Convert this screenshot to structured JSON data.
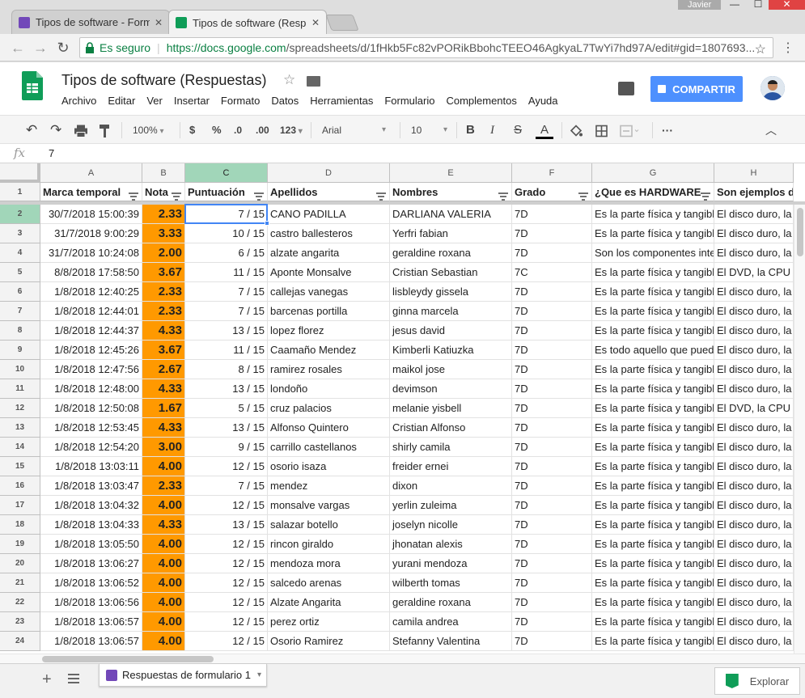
{
  "browser": {
    "tabs": [
      {
        "title": "Tipos de software - Form",
        "favicon_color": "#7248b9"
      },
      {
        "title": "Tipos de software (Respu",
        "favicon_color": "#0f9d58"
      }
    ],
    "user_name": "Javier",
    "secure_label": "Es seguro",
    "url_host": "https://docs.google.com",
    "url_path": "/spreadsheets/d/1fHkb5Fc82vPORikBbohcTEEO46AgkyaL7TwYi7hd97A/edit#gid=1807693..."
  },
  "doc": {
    "title": "Tipos de software (Respuestas)",
    "menus": [
      "Archivo",
      "Editar",
      "Ver",
      "Insertar",
      "Formato",
      "Datos",
      "Herramientas",
      "Formulario",
      "Complementos",
      "Ayuda"
    ],
    "share_label": "COMPARTIR"
  },
  "format_toolbar": {
    "zoom": "100%",
    "currency": "$",
    "percent": "%",
    "dec_less": ".0",
    "dec_more": ".00",
    "more_formats": "123",
    "font": "Arial",
    "font_size": "10",
    "more": "···"
  },
  "formula_bar": {
    "fx": "fx",
    "value": "7"
  },
  "grid": {
    "col_letters": [
      "A",
      "B",
      "C",
      "D",
      "E",
      "F",
      "G",
      "H"
    ],
    "selected_col": "C",
    "headers": [
      "Marca temporal",
      "Nota",
      "Puntuación",
      "Apellidos",
      "Nombres",
      "Grado",
      "¿Que es HARDWARE",
      "Son ejemplos d"
    ],
    "rows": [
      {
        "n": "2",
        "a": "30/7/2018 15:00:39",
        "b": "2.33",
        "c": "7 / 15",
        "d": "CANO PADILLA",
        "e": "DARLIANA VALERIA",
        "f": "7D",
        "g": "Es la parte física y tangibl",
        "h": "El disco duro, la"
      },
      {
        "n": "3",
        "a": "31/7/2018 9:00:29",
        "b": "3.33",
        "c": "10 / 15",
        "d": "castro ballesteros",
        "e": "Yerfri fabian",
        "f": "7D",
        "g": "Es la parte física y tangibl",
        "h": "El disco duro, la"
      },
      {
        "n": "4",
        "a": "31/7/2018 10:24:08",
        "b": "2.00",
        "c": "6 / 15",
        "d": "alzate angarita",
        "e": "geraldine roxana",
        "f": "7D",
        "g": "Son los componentes inte",
        "h": "El disco duro, la"
      },
      {
        "n": "5",
        "a": "8/8/2018 17:58:50",
        "b": "3.67",
        "c": "11 / 15",
        "d": "Aponte Monsalve",
        "e": "Cristian Sebastian",
        "f": "7C",
        "g": "Es la parte física y tangibl",
        "h": "El DVD, la CPU"
      },
      {
        "n": "6",
        "a": "1/8/2018 12:40:25",
        "b": "2.33",
        "c": "7 / 15",
        "d": "callejas vanegas",
        "e": "lisbleydy gissela",
        "f": "7D",
        "g": "Es la parte física y tangibl",
        "h": "El disco duro, la"
      },
      {
        "n": "7",
        "a": "1/8/2018 12:44:01",
        "b": "2.33",
        "c": "7 / 15",
        "d": "barcenas portilla",
        "e": "ginna marcela",
        "f": "7D",
        "g": "Es la parte física y tangibl",
        "h": "El disco duro, la"
      },
      {
        "n": "8",
        "a": "1/8/2018 12:44:37",
        "b": "4.33",
        "c": "13 / 15",
        "d": "lopez florez",
        "e": "jesus david",
        "f": "7D",
        "g": "Es la parte física y tangibl",
        "h": "El disco duro, la"
      },
      {
        "n": "9",
        "a": "1/8/2018 12:45:26",
        "b": "3.67",
        "c": "11 / 15",
        "d": "Caamaño Mendez",
        "e": "Kimberli Katiuzka",
        "f": "7D",
        "g": "Es todo aquello que pued",
        "h": "El disco duro, la"
      },
      {
        "n": "10",
        "a": "1/8/2018 12:47:56",
        "b": "2.67",
        "c": "8 / 15",
        "d": "ramirez rosales",
        "e": "maikol jose",
        "f": "7D",
        "g": "Es la parte física y tangibl",
        "h": "El disco duro, la"
      },
      {
        "n": "11",
        "a": "1/8/2018 12:48:00",
        "b": "4.33",
        "c": "13 / 15",
        "d": "londoño",
        "e": "devimson",
        "f": "7D",
        "g": "Es la parte física y tangibl",
        "h": "El disco duro, la"
      },
      {
        "n": "12",
        "a": "1/8/2018 12:50:08",
        "b": "1.67",
        "c": "5 / 15",
        "d": "cruz palacios",
        "e": "melanie yisbell",
        "f": "7D",
        "g": "Es la parte física y tangibl",
        "h": "El DVD, la CPU"
      },
      {
        "n": "13",
        "a": "1/8/2018 12:53:45",
        "b": "4.33",
        "c": "13 / 15",
        "d": "Alfonso Quintero",
        "e": "Cristian Alfonso",
        "f": "7D",
        "g": "Es la parte física y tangibl",
        "h": "El disco duro, la"
      },
      {
        "n": "14",
        "a": "1/8/2018 12:54:20",
        "b": "3.00",
        "c": "9 / 15",
        "d": "carrillo castellanos",
        "e": "shirly camila",
        "f": "7D",
        "g": "Es la parte física y tangibl",
        "h": "El disco duro, la"
      },
      {
        "n": "15",
        "a": "1/8/2018 13:03:11",
        "b": "4.00",
        "c": "12 / 15",
        "d": "osorio isaza",
        "e": "freider ernei",
        "f": "7D",
        "g": "Es la parte física y tangibl",
        "h": "El disco duro, la"
      },
      {
        "n": "16",
        "a": "1/8/2018 13:03:47",
        "b": "2.33",
        "c": "7 / 15",
        "d": "mendez",
        "e": "dixon",
        "f": "7D",
        "g": "Es la parte física y tangibl",
        "h": "El disco duro, la"
      },
      {
        "n": "17",
        "a": "1/8/2018 13:04:32",
        "b": "4.00",
        "c": "12 / 15",
        "d": "monsalve vargas",
        "e": "yerlin zuleima",
        "f": "7D",
        "g": "Es la parte física y tangibl",
        "h": "El disco duro, la"
      },
      {
        "n": "18",
        "a": "1/8/2018 13:04:33",
        "b": "4.33",
        "c": "13 / 15",
        "d": "salazar botello",
        "e": "joselyn nicolle",
        "f": "7D",
        "g": "Es la parte física y tangibl",
        "h": "El disco duro, la"
      },
      {
        "n": "19",
        "a": "1/8/2018 13:05:50",
        "b": "4.00",
        "c": "12 / 15",
        "d": "rincon giraldo",
        "e": "jhonatan alexis",
        "f": "7D",
        "g": "Es la parte física y tangibl",
        "h": "El disco duro, la"
      },
      {
        "n": "20",
        "a": "1/8/2018 13:06:27",
        "b": "4.00",
        "c": "12 / 15",
        "d": "mendoza mora",
        "e": "yurani mendoza",
        "f": "7D",
        "g": "Es la parte física y tangibl",
        "h": "El disco duro, la"
      },
      {
        "n": "21",
        "a": "1/8/2018 13:06:52",
        "b": "4.00",
        "c": "12 / 15",
        "d": "salcedo arenas",
        "e": "wilberth tomas",
        "f": "7D",
        "g": "Es la parte física y tangibl",
        "h": "El disco duro, la"
      },
      {
        "n": "22",
        "a": "1/8/2018 13:06:56",
        "b": "4.00",
        "c": "12 / 15",
        "d": "Alzate Angarita",
        "e": "geraldine roxana",
        "f": "7D",
        "g": "Es la parte física y tangibl",
        "h": "El disco duro, la"
      },
      {
        "n": "23",
        "a": "1/8/2018 13:06:57",
        "b": "4.00",
        "c": "12 / 15",
        "d": "perez ortiz",
        "e": "camila andrea",
        "f": "7D",
        "g": "Es la parte física y tangibl",
        "h": "El disco duro, la"
      },
      {
        "n": "24",
        "a": "1/8/2018 13:06:57",
        "b": "4.00",
        "c": "12 / 15",
        "d": "Osorio Ramirez",
        "e": "Stefanny Valentina",
        "f": "7D",
        "g": "Es la parte física y tangibl",
        "h": "El disco duro, la"
      }
    ]
  },
  "sheets": {
    "active_tab": "Respuestas de formulario 1",
    "explore_label": "Explorar"
  },
  "colors": {
    "nota_fill": "#ff9900",
    "selection": "#4285f4",
    "share_blue": "#4d90fe",
    "header_selected": "#a1d6b9"
  }
}
